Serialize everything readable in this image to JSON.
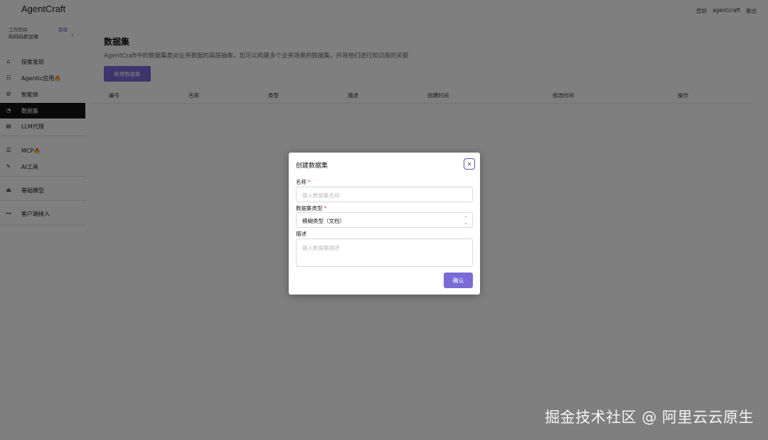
{
  "app": {
    "title": "AgentCraft"
  },
  "header": {
    "greeting": "您好",
    "username": "agentcraft",
    "logout": "登出"
  },
  "workspace": {
    "label": "工作空间",
    "manage": "管理",
    "current": "码码码新加坡"
  },
  "sidebar": {
    "items": [
      {
        "label": "探索发现",
        "icon": "home-icon"
      },
      {
        "label": "Agentic应用🔥",
        "icon": "apps-icon"
      },
      {
        "label": "智能体",
        "icon": "agent-icon"
      },
      {
        "label": "数据集",
        "icon": "dataset-icon",
        "active": true
      },
      {
        "label": "LLM代理",
        "icon": "llm-proxy-icon"
      },
      {
        "label": "MCP🔥",
        "icon": "mcp-icon"
      },
      {
        "label": "AI工具",
        "icon": "tool-icon"
      },
      {
        "label": "基础模型",
        "icon": "model-icon"
      },
      {
        "label": "客户端接入",
        "icon": "client-icon"
      }
    ]
  },
  "page": {
    "title": "数据集",
    "description": "AgentCraft中的数据集是对业务数据的高层抽象，您可以构建多个业务场景的数据集，并将他们进行知识库的关联",
    "new_button": "新建数据集",
    "columns": [
      "编号",
      "名称",
      "类型",
      "描述",
      "创建时间",
      "修改时间",
      "操作"
    ]
  },
  "modal": {
    "title": "创建数据集",
    "name_label": "名称",
    "name_placeholder": "输入数据集名称",
    "type_label": "数据集类型",
    "type_value": "模糊类型（文档）",
    "desc_label": "描述",
    "desc_placeholder": "输入数据集描述",
    "confirm": "确认",
    "required_mark": "*"
  },
  "watermark": "掘金技术社区 @ 阿里云云原生",
  "colors": {
    "accent": "#7b6bd6",
    "sidebar_active": "#151515",
    "overlay": "rgba(0,0,0,0.5)"
  }
}
